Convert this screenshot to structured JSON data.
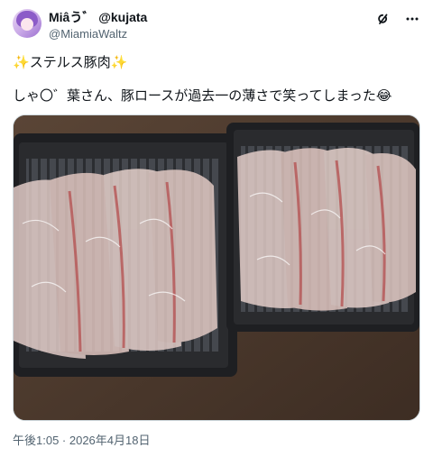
{
  "author": {
    "display_name": "Miâう゛ @kujata",
    "handle": "@MiamiaWaltz"
  },
  "icons": {
    "grok": "grok-icon",
    "more": "more-icon",
    "sparkle": "sparkles-emoji",
    "laugh": "tears-of-joy-emoji"
  },
  "tweet": {
    "line1_prefix": "✨",
    "line1_text": "ステルス豚肉",
    "line1_suffix": "✨",
    "line2_text": "しゃ〇゛葉さん、豚ロースが過去一の薄さで笑ってしまった",
    "line2_emoji": "😂"
  },
  "timestamp": "午後1:05 · 2026年4月18日",
  "colors": {
    "text": "#0f1419",
    "secondary": "#536471",
    "border": "#cfd9de"
  }
}
